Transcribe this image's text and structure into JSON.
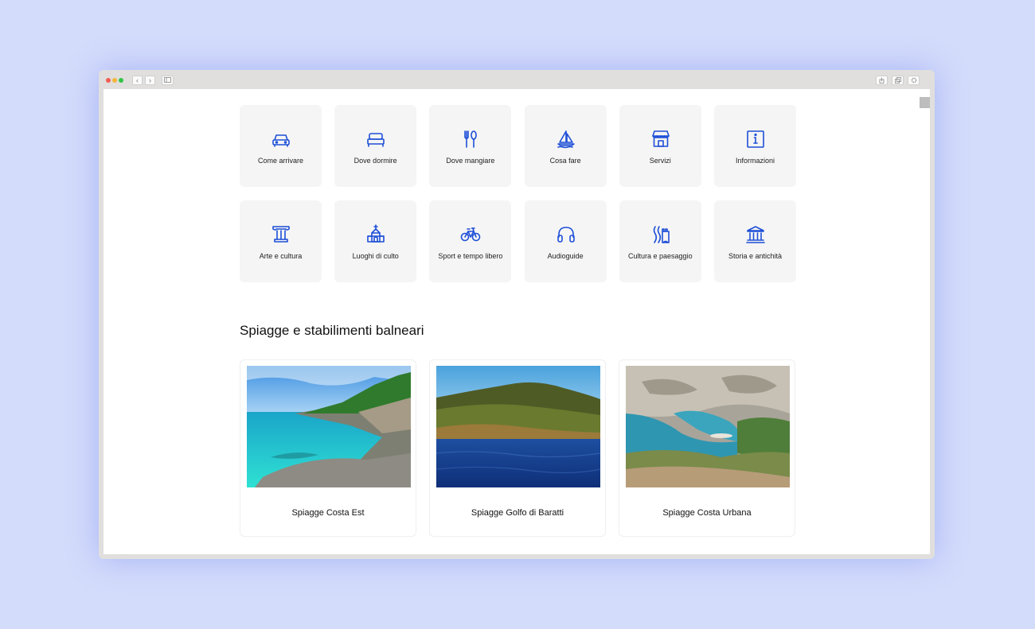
{
  "browser": {
    "back_glyph": "‹",
    "forward_glyph": "›"
  },
  "colors": {
    "background": "#d4dcfb",
    "icon": "#1d4fd7",
    "tile": "#f5f5f5"
  },
  "services": [
    {
      "label": "Come arrivare",
      "icon": "car-icon"
    },
    {
      "label": "Dove dormire",
      "icon": "bed-icon"
    },
    {
      "label": "Dove mangiare",
      "icon": "cutlery-icon"
    },
    {
      "label": "Cosa fare",
      "icon": "sailboat-icon"
    },
    {
      "label": "Servizi",
      "icon": "shop-icon"
    },
    {
      "label": "Informazioni",
      "icon": "info-icon"
    },
    {
      "label": "Arte e cultura",
      "icon": "column-icon"
    },
    {
      "label": "Luoghi di culto",
      "icon": "church-icon"
    },
    {
      "label": "Sport e tempo libero",
      "icon": "bicycle-icon"
    },
    {
      "label": "Audioguide",
      "icon": "headphones-icon"
    },
    {
      "label": "Cultura e paesaggio",
      "icon": "landscape-icon"
    },
    {
      "label": "Storia e antichità",
      "icon": "museum-icon"
    }
  ],
  "beaches": {
    "title": "Spiagge e stabilimenti balneari",
    "cards": [
      {
        "caption": "Spiagge Costa Est",
        "image": "turquoise-coast-photo"
      },
      {
        "caption": "Spiagge Golfo di Baratti",
        "image": "green-hill-sea-photo"
      },
      {
        "caption": "Spiagge Costa Urbana",
        "image": "rocky-cove-photo"
      }
    ]
  }
}
